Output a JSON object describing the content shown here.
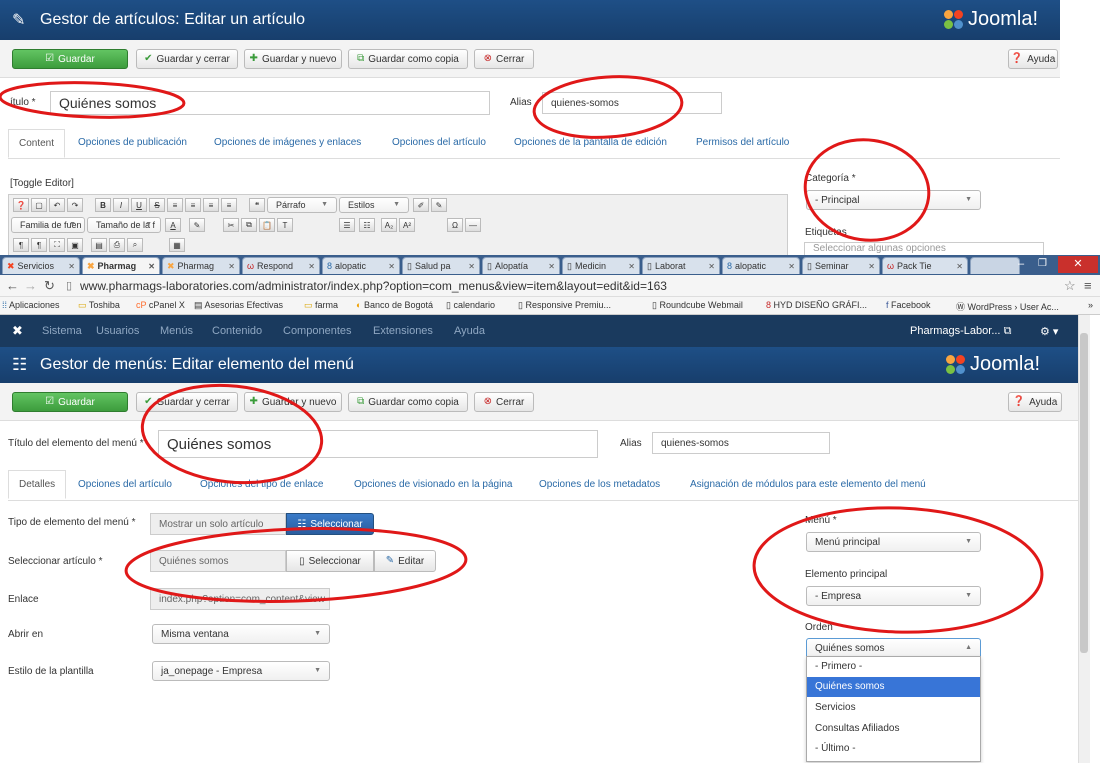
{
  "top": {
    "title": "Gestor de artículos: Editar un artículo",
    "brand": "Joomla!",
    "toolbar": {
      "save": "Guardar",
      "save_close": "Guardar y cerrar",
      "save_new": "Guardar y nuevo",
      "save_copy": "Guardar como copia",
      "close": "Cerrar",
      "help": "Ayuda"
    },
    "title_label": "ítulo *",
    "title_value": "Quiénes somos",
    "alias_label": "Alias",
    "alias_value": "quienes-somos",
    "tabs": [
      "Content",
      "Opciones de publicación",
      "Opciones de imágenes y enlaces",
      "Opciones del artículo",
      "Opciones de la pantalla de edición",
      "Permisos del artículo"
    ],
    "toggle_editor": "[Toggle Editor]",
    "editor": {
      "paragraph": "Párrafo",
      "styles": "Estilos",
      "font_family": "Familia de fuen",
      "font_size": "Tamaño de la f"
    },
    "category_label": "Categoría *",
    "category_value": "- Principal",
    "tags_label": "Etiquetas",
    "tags_placeholder": "Seleccionar algunas opciones"
  },
  "browser": {
    "tabs": [
      "Servicios",
      "Pharmag",
      "Pharmag",
      "Respond",
      "alopatic",
      "Salud pa",
      "Alopatía",
      "Medicin",
      "Laborat",
      "alopatic",
      "Seminar",
      "Pack Tie"
    ],
    "url": "www.pharmags-laboratories.com/administrator/index.php?option=com_menus&view=item&layout=edit&id=163",
    "bookmarks": [
      "Aplicaciones",
      "Toshiba",
      "cPanel X",
      "Asesorias Efectivas",
      "farma",
      "Banco de Bogotá",
      "calendario",
      "Responsive Premiu...",
      "Roundcube Webmail",
      "HYD DISEÑO GRÁFI...",
      "Facebook",
      "WordPress › User Ac...",
      "»"
    ]
  },
  "admin": {
    "menu": [
      "Sistema",
      "Usuarios",
      "Menús",
      "Contenido",
      "Componentes",
      "Extensiones",
      "Ayuda"
    ],
    "site": "Pharmags-Labor..."
  },
  "bottom": {
    "title": "Gestor de menús: Editar elemento del menú",
    "brand": "Joomla!",
    "toolbar": {
      "save": "Guardar",
      "save_close": "Guardar y cerrar",
      "save_new": "Guardar y nuevo",
      "save_copy": "Guardar como copia",
      "close": "Cerrar",
      "help": "Ayuda"
    },
    "title_label": "Título del elemento del menú *",
    "title_value": "Quiénes somos",
    "alias_label": "Alias",
    "alias_value": "quienes-somos",
    "tabs": [
      "Detalles",
      "Opciones del artículo",
      "Opciones del tipo de enlace",
      "Opciones de visionado en la página",
      "Opciones de los metadatos",
      "Asignación de módulos para este elemento del menú"
    ],
    "fields": {
      "type_label": "Tipo de elemento del menú *",
      "type_value": "Mostrar un solo artículo",
      "type_button": "Seleccionar",
      "article_label": "Seleccionar artículo *",
      "article_value": "Quiénes somos",
      "article_select": "Seleccionar",
      "article_edit": "Editar",
      "link_label": "Enlace",
      "link_value": "index.php?option=com_content&view",
      "open_label": "Abrir en",
      "open_value": "Misma ventana",
      "style_label": "Estilo de la plantilla",
      "style_value": "ja_onepage - Empresa"
    },
    "right": {
      "menu_label": "Menú *",
      "menu_value": "Menú principal",
      "parent_label": "Elemento principal",
      "parent_value": "- Empresa",
      "order_label": "Orden",
      "order_value": "Quiénes somos",
      "order_options": [
        "- Primero -",
        "Quiénes somos",
        "Servicios",
        "Consultas Afiliados",
        "- Último -"
      ]
    }
  },
  "colors": {
    "header_blue": "#1e4f86",
    "admin_bar": "#1a3a5e",
    "save_green": "#4cae4c",
    "annotation_red": "#e01818",
    "highlight": "#3875d7"
  }
}
